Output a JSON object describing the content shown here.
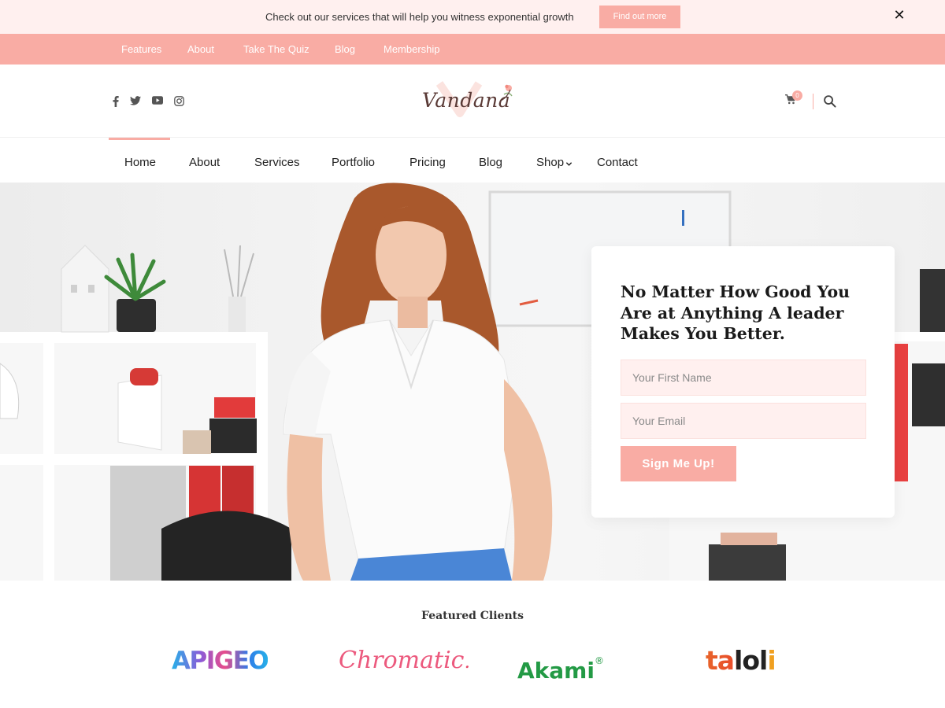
{
  "announcement": {
    "text": "Check out our services that will help you witness exponential growth",
    "cta_label": "Find out more",
    "close_icon": "close-icon"
  },
  "secondary_nav": {
    "items": [
      "Features",
      "About",
      "Take The Quiz",
      "Blog",
      "Membership"
    ]
  },
  "header": {
    "logo_text": "Vandana",
    "social_icons": [
      "facebook-icon",
      "twitter-icon",
      "youtube-icon",
      "instagram-icon"
    ],
    "cart_count": "0",
    "cart_icon": "cart-icon",
    "search_icon": "search-icon"
  },
  "main_nav": {
    "items": [
      "Home",
      "About",
      "Services",
      "Portfolio",
      "Pricing",
      "Blog",
      "Shop",
      "Contact"
    ],
    "active": "Home"
  },
  "hero": {
    "title": "No Matter How Good You Are at Anything A leader Makes You Better.",
    "first_name_placeholder": "Your First Name",
    "email_placeholder": "Your Email",
    "submit_label": "Sign Me Up!"
  },
  "clients": {
    "heading": "Featured Clients",
    "logos": [
      "APIGEO",
      "Chromatic",
      "Akami",
      "taloli"
    ],
    "akami_mark": "®"
  },
  "colors": {
    "accent": "#f9aca4",
    "accent_light": "#fff0ef",
    "text_dark": "#1a1a1a"
  }
}
